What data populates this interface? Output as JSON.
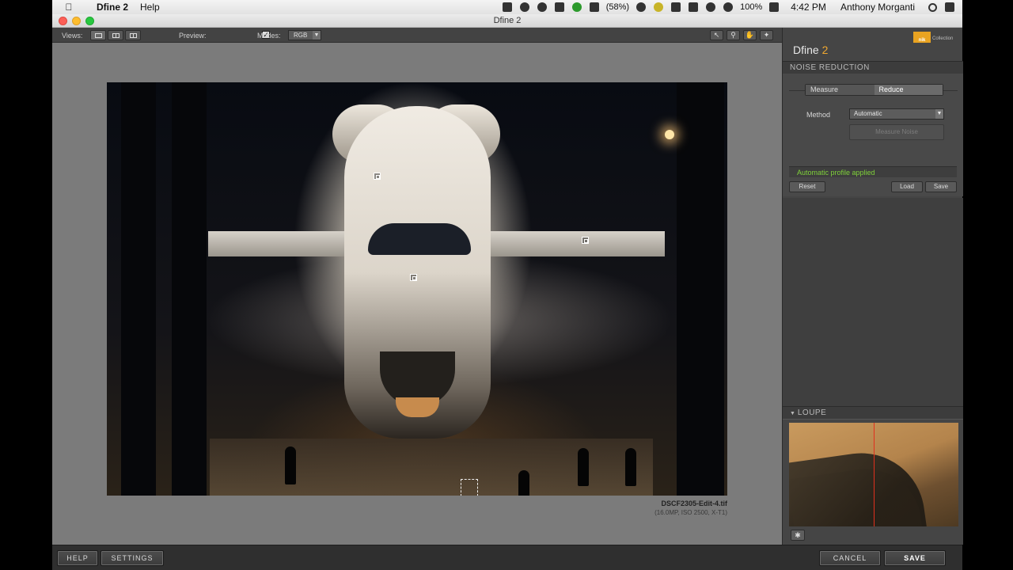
{
  "menubar": {
    "app_name": "Dfine 2",
    "menu_help": "Help",
    "battery_percent": "(58%)",
    "battery_level": "100%",
    "time": "4:42 PM",
    "user": "Anthony Morganti"
  },
  "window": {
    "title": "Dfine 2"
  },
  "toolbar": {
    "views_label": "Views:",
    "preview_label": "Preview:",
    "preview_checked": true,
    "modes_label": "Modes:",
    "mode_value": "RGB"
  },
  "image": {
    "filename": "DSCF2305-Edit-4.tif",
    "meta": "(16.0MP, ISO 2500, X-T1)"
  },
  "panel": {
    "logo_text": "Collection",
    "logo_brand": "nik",
    "title_main": "Dfine",
    "title_num": "2",
    "noise_reduction_header": "NOISE REDUCTION",
    "tabs": [
      {
        "label": "Measure",
        "selected": false
      },
      {
        "label": "Reduce",
        "selected": true
      }
    ],
    "method_label": "Method",
    "method_value": "Automatic",
    "measure_noise_label": "Measure Noise",
    "status_text": "Automatic profile applied",
    "status_color": "#7fd13a",
    "reset_label": "Reset",
    "load_label": "Load",
    "save_label": "Save",
    "loupe_header": "LOUPE"
  },
  "bottom": {
    "help_label": "HELP",
    "settings_label": "SETTINGS",
    "cancel_label": "CANCEL",
    "save_label": "SAVE"
  },
  "colors": {
    "accent": "#f0a830",
    "panel_bg": "#454545",
    "canvas_bg": "#7b7b7b"
  }
}
